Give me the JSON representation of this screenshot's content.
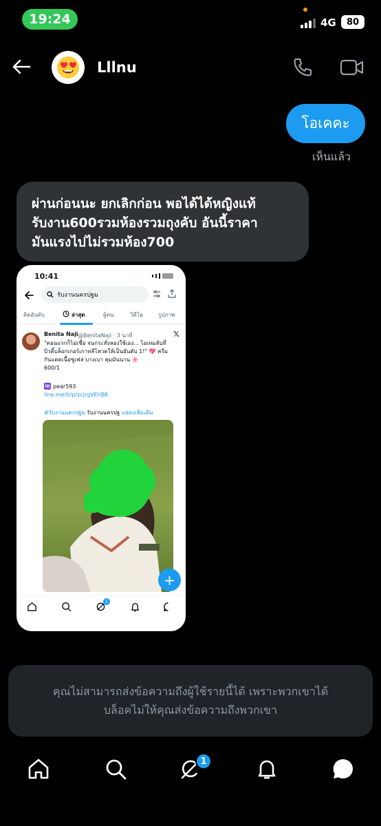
{
  "status_bar": {
    "time": "19:24",
    "network": "4G",
    "battery": "80"
  },
  "header": {
    "contact_name": "Lllnu"
  },
  "messages": {
    "sent_text": "โอเคคะ",
    "seen_label": "เห็นแล้ว",
    "received_lines": [
      "ผ่านก่อนนะ ยกเลิกก่อน พอได้ได้หญิงแท้",
      "รับงาน600รวมห้องรวมถุงคับ อันนี้ราคา",
      "มันแรงไปไม่รวมห้อง700"
    ]
  },
  "attachment": {
    "time": "10:41",
    "search_query": "รับงานนครปฐม",
    "tabs": [
      "ติดอันดับ",
      "ล่าสุด",
      "ผู้คน",
      "วิดีโอ",
      "รูปภาพ"
    ],
    "active_tab": "ล่าสุด",
    "post": {
      "author": "Benita Naji",
      "handle": "@BenitaNaji · 3 นาที",
      "text_lines": [
        "\"ตอนแรกก็ไม่เชื่อ จนกระทั่งลองใช้เอง... ไอเทมลับที่",
        "บิวตี้บล็อกเกอร์เกาหลีโหวตให้เป็นอันดับ 1!\" 💖 ครีม",
        "กันแดดเนื้อซูเฟล่ บางเบา คุมมันนาน 🌸",
        "600/1"
      ],
      "id_badge": "ID",
      "id_name": "pear593",
      "link": "line.me/ti/p/zcjrgVEhBK",
      "hashtag": "#รับงานนครปฐม",
      "tag_text": " รับงานนครปฐ",
      "show_more": " แสดงเพิ่มเติม"
    },
    "fab_label": "+",
    "notification_count": "1"
  },
  "notice": {
    "line1": "คุณไม่สามารถส่งข้อความถึงผู้ใช้รายนี้ได้ เพราะพวกเขาได้",
    "line2": "บล็อคไม่ให้คุณส่งข้อความถึงพวกเขา"
  },
  "bottom_nav": {
    "badge_count": "1"
  },
  "colors": {
    "accent": "#1d9bf0",
    "bubble_received": "#2f3336",
    "status_green": "#34c759"
  }
}
